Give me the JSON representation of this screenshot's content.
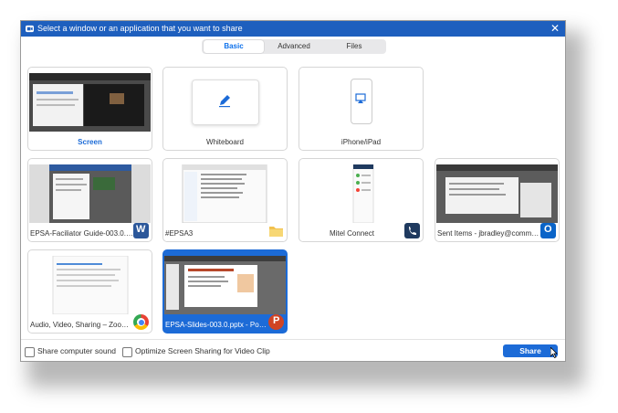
{
  "window": {
    "title": "Select a window or an application that you want to share",
    "close": "✕"
  },
  "tabs": [
    {
      "label": "Basic"
    },
    {
      "label": "Advanced"
    },
    {
      "label": "Files"
    }
  ],
  "tiles": [
    {
      "label": "Screen",
      "selected": false
    },
    {
      "label": "Whiteboard",
      "selected": false
    },
    {
      "label": "iPhone/iPad",
      "selected": false
    },
    {
      "label": "EPSA-Faciliator Guide-003.0.docx...",
      "app": "word-icon",
      "selected": false
    },
    {
      "label": "#EPSA3",
      "app": "folder-icon",
      "selected": false
    },
    {
      "label": "Mitel Connect",
      "app": "mitel-icon",
      "selected": false
    },
    {
      "label": "Sent Items - jbradley@communis...",
      "app": "outlook-icon",
      "selected": false
    },
    {
      "label": "Audio, Video, Sharing – Zoom He...",
      "app": "chrome-icon",
      "selected": false
    },
    {
      "label": "EPSA-Slides-003.0.pptx - PowerP...",
      "app": "powerpoint-icon",
      "selected": true
    }
  ],
  "footer": {
    "share_sound": "Share computer sound",
    "optimize": "Optimize Screen Sharing for Video Clip",
    "share_button": "Share"
  },
  "colors": {
    "accent": "#1c6bd7",
    "titlebar": "#1e5fbe"
  }
}
